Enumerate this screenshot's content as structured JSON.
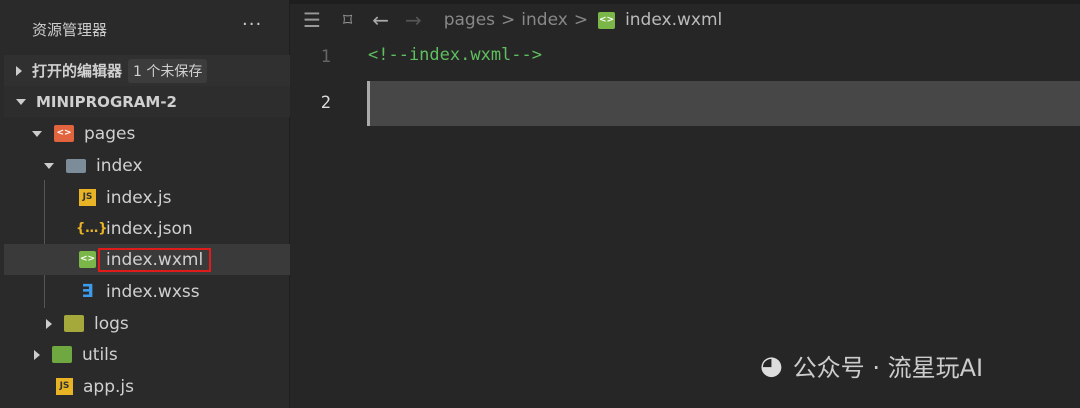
{
  "sidebar": {
    "title": "资源管理器",
    "more": "···",
    "open_editors": "打开的编辑器",
    "unsaved": "1 个未保存",
    "project": "MINIPROGRAM-2",
    "tree": [
      {
        "label": "pages"
      },
      {
        "label": "index"
      },
      {
        "label": "index.js"
      },
      {
        "label": "index.json"
      },
      {
        "label": "index.wxml"
      },
      {
        "label": "index.wxss"
      },
      {
        "label": "logs"
      },
      {
        "label": "utils"
      },
      {
        "label": "app.js"
      }
    ]
  },
  "editor": {
    "breadcrumb": [
      "pages",
      "index",
      "index.wxml"
    ],
    "sep": ">",
    "lines": [
      "1",
      "2"
    ],
    "code": "<!--index.wxml-->"
  },
  "watermark": "公众号 · 流星玩AI"
}
